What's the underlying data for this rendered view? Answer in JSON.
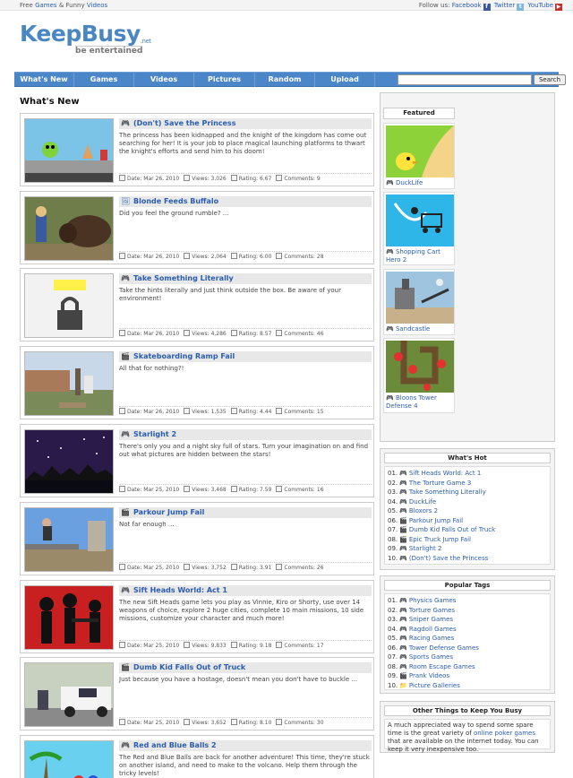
{
  "topbar": {
    "left_prefix": "Free",
    "left_link1": "Games",
    "left_mid": "&",
    "left_mid2": "Funny",
    "left_link2": "Videos",
    "follow": "Follow us:",
    "facebook": "Facebook",
    "twitter": "Twitter",
    "youtube": "YouTube"
  },
  "header": {
    "brand": "KeepBusy",
    "brand_suffix": ".net",
    "tagline": "be entertained"
  },
  "nav": {
    "items": [
      "What's New",
      "Games",
      "Videos",
      "Pictures",
      "Random",
      "Upload"
    ],
    "search_placeholder": "",
    "search_button": "Search"
  },
  "main": {
    "section_title": "What's New",
    "meta_labels": {
      "date": "Date:",
      "views": "Views:",
      "rating": "Rating:",
      "comments": "Comments:"
    },
    "items": [
      {
        "type": "game",
        "title": "(Don't) Save the Princess",
        "desc": "The princess has been kidnapped and the knight of the kingdom has come out searching for her! It is your job to place magical launching platforms to thwart the knight's efforts and send him to his doom!",
        "date": "Mar 26, 2010",
        "views": "3,026",
        "rating": "6.67",
        "comments": "9"
      },
      {
        "type": "picture",
        "title": "Blonde Feeds Buffalo",
        "desc": "Did you feel the ground rumble? ...",
        "date": "Mar 26, 2010",
        "views": "2,064",
        "rating": "6.00",
        "comments": "28"
      },
      {
        "type": "game",
        "title": "Take Something Literally",
        "desc": "Take the hints literally and just think outside the box. Be aware of your environment!",
        "date": "Mar 26, 2010",
        "views": "4,286",
        "rating": "8.57",
        "comments": "46"
      },
      {
        "type": "video",
        "title": "Skateboarding Ramp Fail",
        "desc": "All that for nothing?!",
        "date": "Mar 26, 2010",
        "views": "1,535",
        "rating": "4.44",
        "comments": "15"
      },
      {
        "type": "game",
        "title": "Starlight 2",
        "desc": "There's only you and a night sky full of stars. Turn your imagination on and find out what pictures are hidden between the stars!",
        "date": "Mar 25, 2010",
        "views": "3,468",
        "rating": "7.59",
        "comments": "16"
      },
      {
        "type": "video",
        "title": "Parkour Jump Fail",
        "desc": "Not far enough ...",
        "date": "Mar 25, 2010",
        "views": "3,752",
        "rating": "3.91",
        "comments": "26"
      },
      {
        "type": "game",
        "title": "Sift Heads World: Act 1",
        "desc": "The new Sift Heads game lets you play as Vinnie, Kiro or Shorty, use over 14 weapons of choice, explore 2 huge cities, complete 10 main missions, 10 side missions, customize your character and much more!",
        "date": "Mar 25, 2010",
        "views": "9,833",
        "rating": "9.18",
        "comments": "17"
      },
      {
        "type": "video",
        "title": "Dumb Kid Falls Out of Truck",
        "desc": "Just because you have a hostage, doesn't mean you don't have to buckle ...",
        "date": "Mar 25, 2010",
        "views": "3,652",
        "rating": "8.10",
        "comments": "30"
      },
      {
        "type": "game",
        "title": "Red and Blue Balls 2",
        "desc": "The Red and Blue Balls are back for another adventure! This time, they're stuck on another island, and need to make to the volcano. Help them through the tricky levels!",
        "date": "",
        "views": "",
        "rating": "",
        "comments": ""
      }
    ]
  },
  "sidebar": {
    "featured_title": "Featured",
    "featured": [
      {
        "name": "DuckLife"
      },
      {
        "name": "Shopping Cart Hero 2"
      },
      {
        "name": "Sandcastle"
      },
      {
        "name": "Bloons Tower Defense 4"
      }
    ],
    "hot_title": "What's Hot",
    "hot": [
      {
        "n": "01.",
        "name": "Sift Heads World: Act 1",
        "type": "game"
      },
      {
        "n": "02.",
        "name": "The Torture Game 3",
        "type": "game"
      },
      {
        "n": "03.",
        "name": "Take Something Literally",
        "type": "game"
      },
      {
        "n": "04.",
        "name": "DuckLife",
        "type": "game"
      },
      {
        "n": "05.",
        "name": "Bloxors 2",
        "type": "game"
      },
      {
        "n": "06.",
        "name": "Parkour Jump Fail",
        "type": "video"
      },
      {
        "n": "07.",
        "name": "Dumb Kid Falls Out of Truck",
        "type": "video"
      },
      {
        "n": "08.",
        "name": "Epic Truck Jump Fail",
        "type": "video"
      },
      {
        "n": "09.",
        "name": "Starlight 2",
        "type": "game"
      },
      {
        "n": "10.",
        "name": "(Don't) Save the Princess",
        "type": "game"
      }
    ],
    "tags_title": "Popular Tags",
    "tags": [
      {
        "n": "01.",
        "name": "Physics Games",
        "type": "game"
      },
      {
        "n": "02.",
        "name": "Torture Games",
        "type": "game"
      },
      {
        "n": "03.",
        "name": "Sniper Games",
        "type": "game"
      },
      {
        "n": "04.",
        "name": "Ragdoll Games",
        "type": "game"
      },
      {
        "n": "05.",
        "name": "Racing Games",
        "type": "game"
      },
      {
        "n": "06.",
        "name": "Tower Defense Games",
        "type": "game"
      },
      {
        "n": "07.",
        "name": "Sports Games",
        "type": "game"
      },
      {
        "n": "08.",
        "name": "Room Escape Games",
        "type": "game"
      },
      {
        "n": "09.",
        "name": "Prank Videos",
        "type": "video"
      },
      {
        "n": "10.",
        "name": "Picture Galleries",
        "type": "folder"
      }
    ],
    "other_title": "Other Things to Keep You Busy",
    "other_text_1": "A much appreciated way to spend some spare time is the great variety of",
    "other_link": "online poker games",
    "other_text_2": "that are available on the internet today. You can keep it very inexpensive too."
  },
  "colors": {
    "nav": "#4a86c8",
    "link": "#2a5db0",
    "brand": "#4b86c4"
  }
}
